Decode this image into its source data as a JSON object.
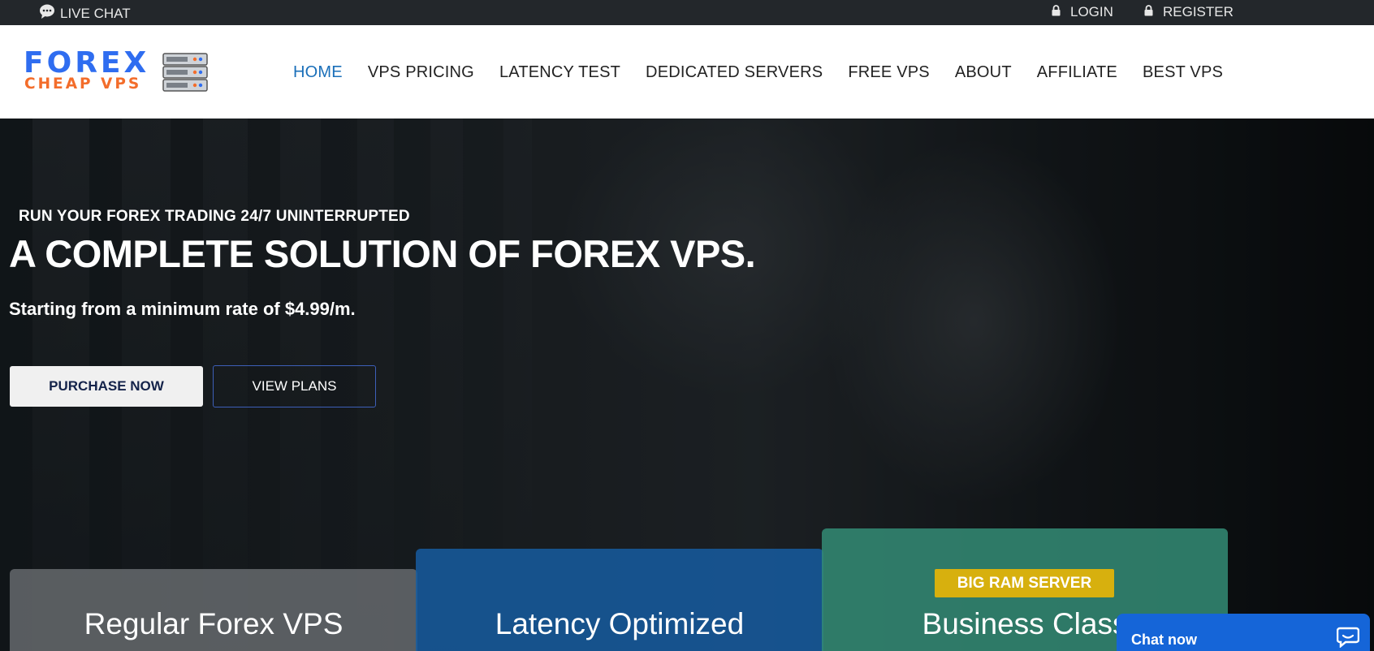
{
  "topbar": {
    "live_chat": "LIVE CHAT",
    "login": "LOGIN",
    "register": "REGISTER",
    "icons": [
      "chat-bubble-icon",
      "lock-icon",
      "lock-icon"
    ]
  },
  "logo": {
    "line1": "FOREX",
    "line2": "CHEAP VPS",
    "icon": "server-rack-icon"
  },
  "nav": {
    "items": [
      {
        "label": "HOME",
        "active": true
      },
      {
        "label": "VPS PRICING"
      },
      {
        "label": "LATENCY TEST"
      },
      {
        "label": "DEDICATED SERVERS"
      },
      {
        "label": "FREE VPS"
      },
      {
        "label": "ABOUT"
      },
      {
        "label": "AFFILIATE"
      },
      {
        "label": "BEST VPS"
      }
    ]
  },
  "hero": {
    "kicker": "RUN YOUR FOREX TRADING 24/7 UNINTERRUPTED",
    "headline": "A COMPLETE SOLUTION OF FOREX VPS.",
    "sub": "Starting from a minimum rate of $4.99/m.",
    "purchase": "PURCHASE NOW",
    "plans": "VIEW PLANS"
  },
  "cards": [
    {
      "title": "Regular Forex VPS"
    },
    {
      "title": "Latency Optimized"
    },
    {
      "title": "Business Class",
      "badge": "BIG RAM SERVER"
    }
  ],
  "chat_widget": {
    "label": "Chat now",
    "icon": "chat-icon"
  },
  "colors": {
    "topbar": "#23272b",
    "nav_active": "#1a6fb9",
    "logo_blue": "#2f6df0",
    "logo_orange": "#f36d2b",
    "card_blue": "#165ca0",
    "card_green": "#348c76",
    "badge": "#d7b00e",
    "chat": "#1565d8"
  }
}
